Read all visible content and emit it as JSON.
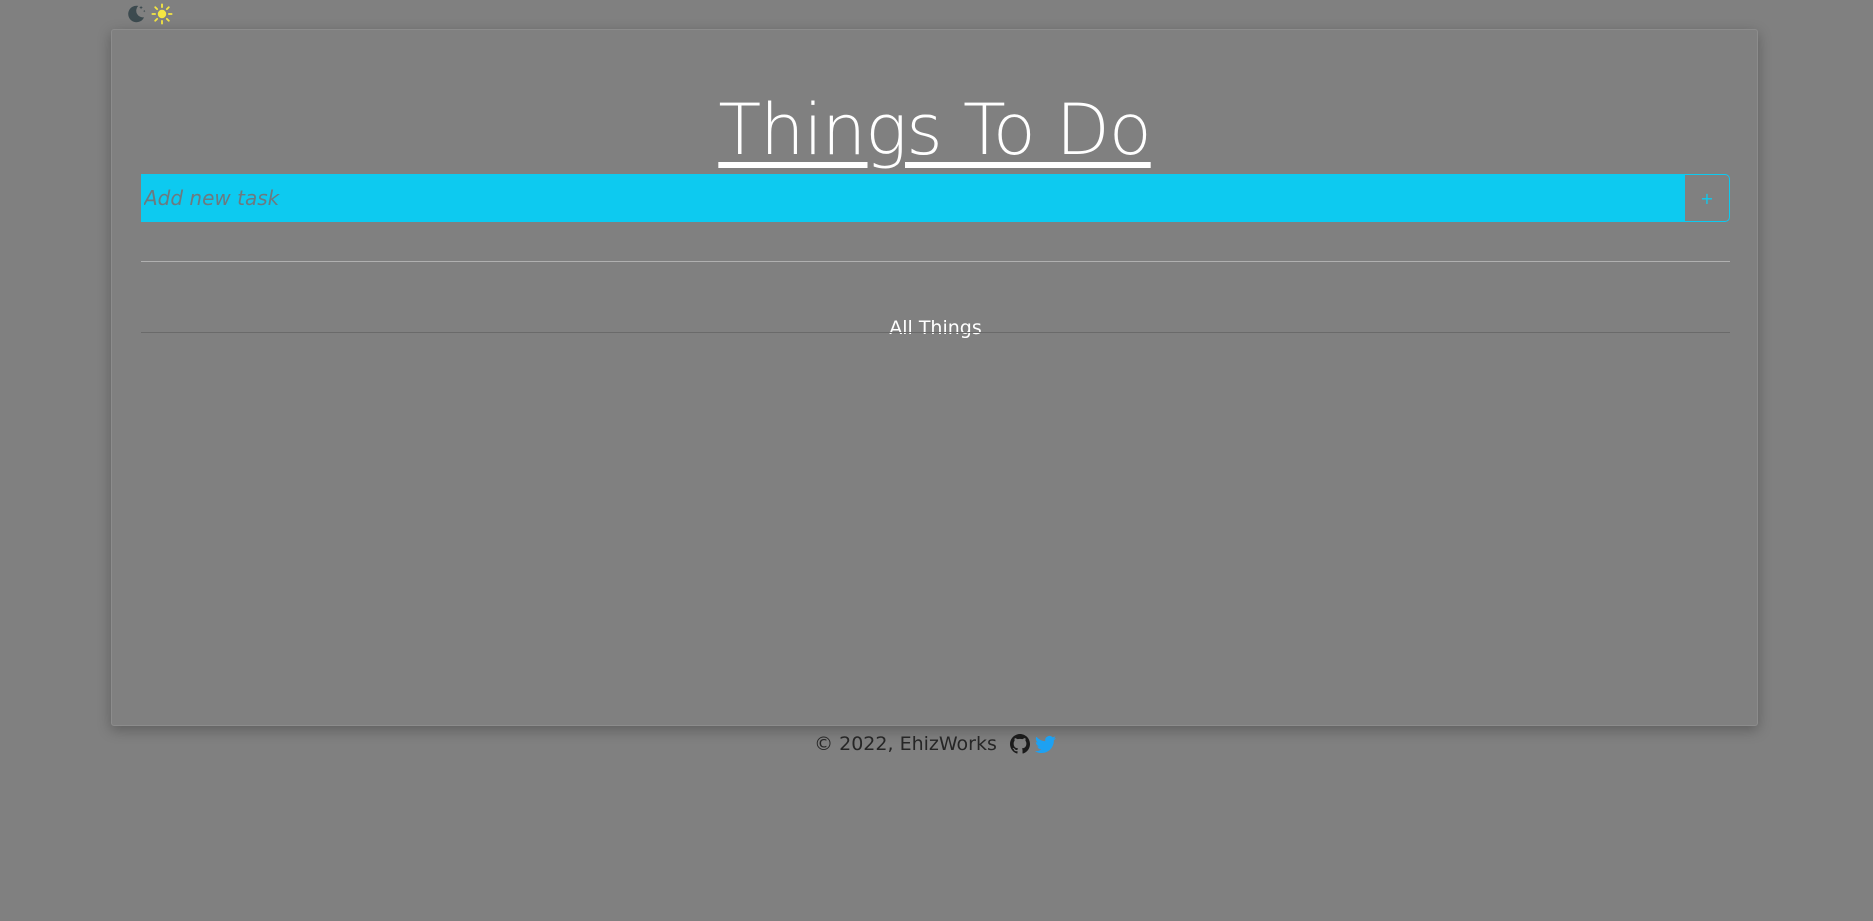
{
  "theme_toggle": {
    "dark_icon": "moon-stars-icon",
    "light_icon": "sun-icon",
    "light_icon_color": "#f5e642"
  },
  "title": "Things To Do",
  "task_form": {
    "placeholder": "Add new task",
    "value": "",
    "add_label": "+",
    "accent_color": "#0dcaf0"
  },
  "filter": {
    "label": "All Things"
  },
  "tasks": [],
  "footer": {
    "copyright": "© 2022, EhizWorks",
    "links": [
      {
        "icon": "github-icon"
      },
      {
        "icon": "twitter-icon",
        "color": "#1da1f2"
      }
    ]
  }
}
